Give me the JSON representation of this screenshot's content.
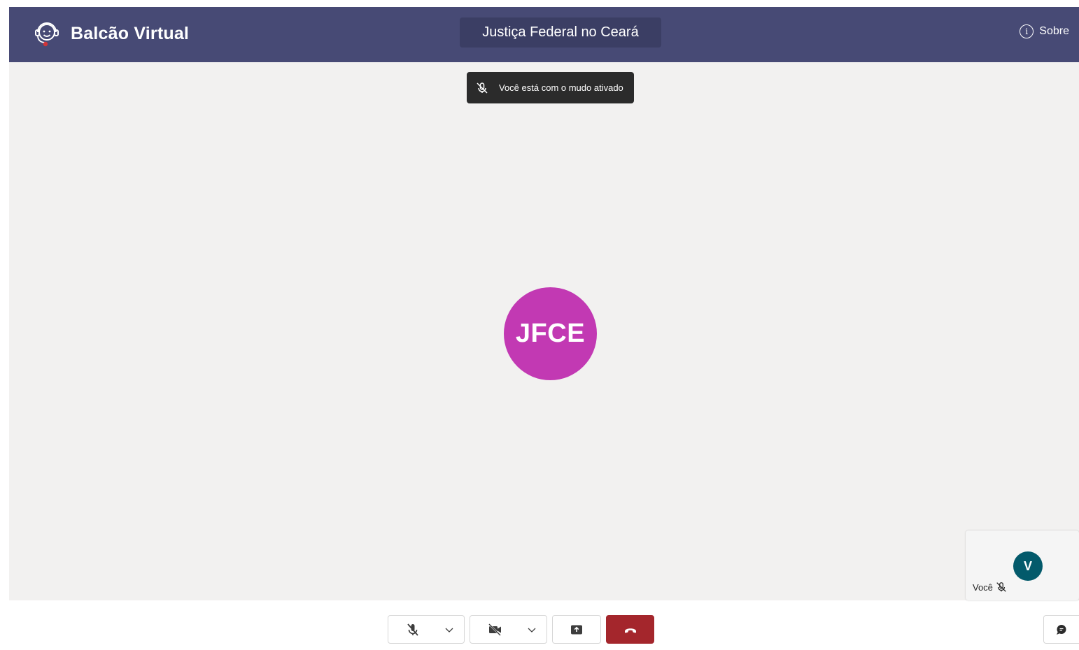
{
  "app": {
    "title": "Balcão Virtual"
  },
  "header": {
    "org_name": "Justiça Federal no Ceará",
    "about_label": "Sobre"
  },
  "toast": {
    "message": "Você está com o mudo ativado",
    "icon": "mic-off-icon"
  },
  "main_participant": {
    "initials": "JFCE",
    "avatar_color": "#c239b3"
  },
  "self_view": {
    "initial": "V",
    "label": "Você",
    "avatar_color": "#035a6b",
    "muted": true
  },
  "controls": {
    "microphone": {
      "state": "muted",
      "icon": "mic-off-icon"
    },
    "camera": {
      "state": "off",
      "icon": "camera-off-icon"
    },
    "share_screen": {
      "icon": "share-screen-icon"
    },
    "hangup": {
      "icon": "hangup-icon",
      "color": "#a4262c"
    },
    "chat": {
      "icon": "chat-icon"
    }
  },
  "colors": {
    "header_bg": "#474a75",
    "stage_bg": "#f2f1f0"
  }
}
